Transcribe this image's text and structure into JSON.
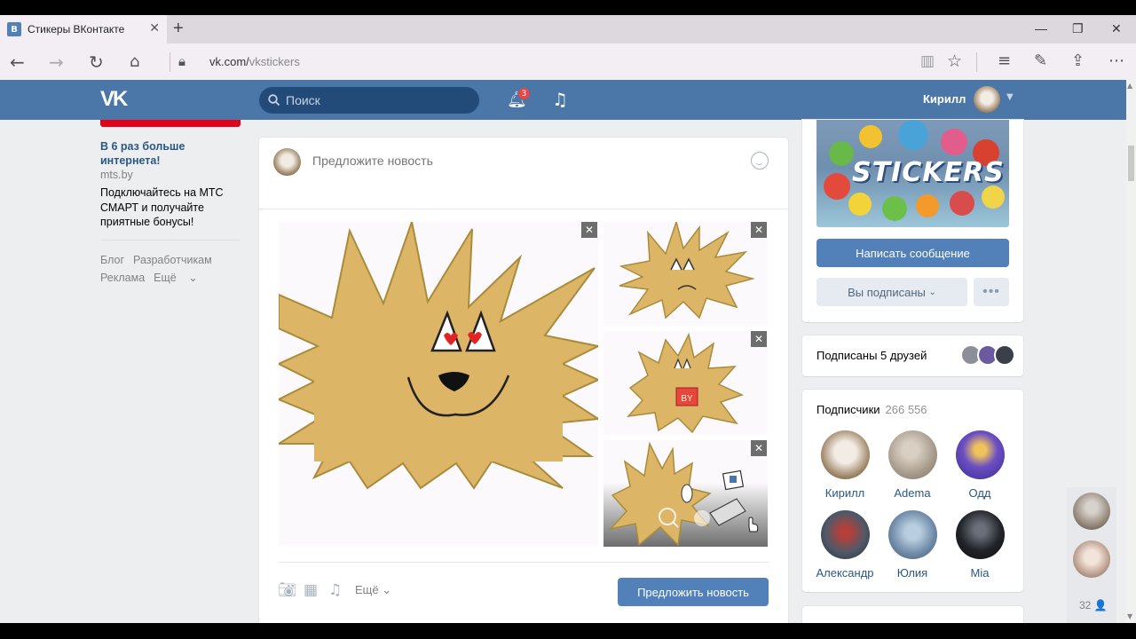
{
  "browser": {
    "tab_title": "Стикеры ВКонтакте",
    "tab_icon": "В",
    "tab_close": "✕",
    "new_tab": "+",
    "url_host": "vk.com/",
    "url_path": "vkstickers",
    "controls": {
      "minimize": "—",
      "restore": "❐",
      "close": "✕"
    }
  },
  "header": {
    "logo": "VK",
    "search_placeholder": "Поиск",
    "notifications_count": "3",
    "user_name": "Кирилл"
  },
  "left": {
    "ad_title": "В 6 раз больше интернета!",
    "ad_domain": "mts.by",
    "ad_text": "Подключайтесь на МТС СМАРТ и получайте приятные бонусы!",
    "links": [
      "Блог",
      "Разработчикам",
      "Реклама",
      "Ещё"
    ],
    "more_caret": "⌄"
  },
  "post": {
    "placeholder": "Предложите новость",
    "more_label": "Ещё",
    "submit_label": "Предложить новость",
    "attachment_close": "✕",
    "sticker_text": "BY"
  },
  "right": {
    "cover_title": "STICKERS",
    "message_button": "Написать сообщение",
    "subscribed_button": "Вы подписаны",
    "dots_button": "•••",
    "friends_text": "Подписаны 5 друзей",
    "subscribers_label": "Подписчики",
    "subscribers_count": "266 556",
    "subscribers": [
      {
        "name": "Кирилл"
      },
      {
        "name": "Adema"
      },
      {
        "name": "Одд"
      },
      {
        "name": "Александр"
      },
      {
        "name": "Юлия"
      },
      {
        "name": "Mia"
      }
    ]
  },
  "float": {
    "count": "32 👤"
  },
  "colors": {
    "vk_blue": "#4a76a8",
    "button_blue": "#5181b8",
    "link": "#2a5885",
    "badge_red": "#e64646",
    "ad_red": "#e3001b"
  }
}
